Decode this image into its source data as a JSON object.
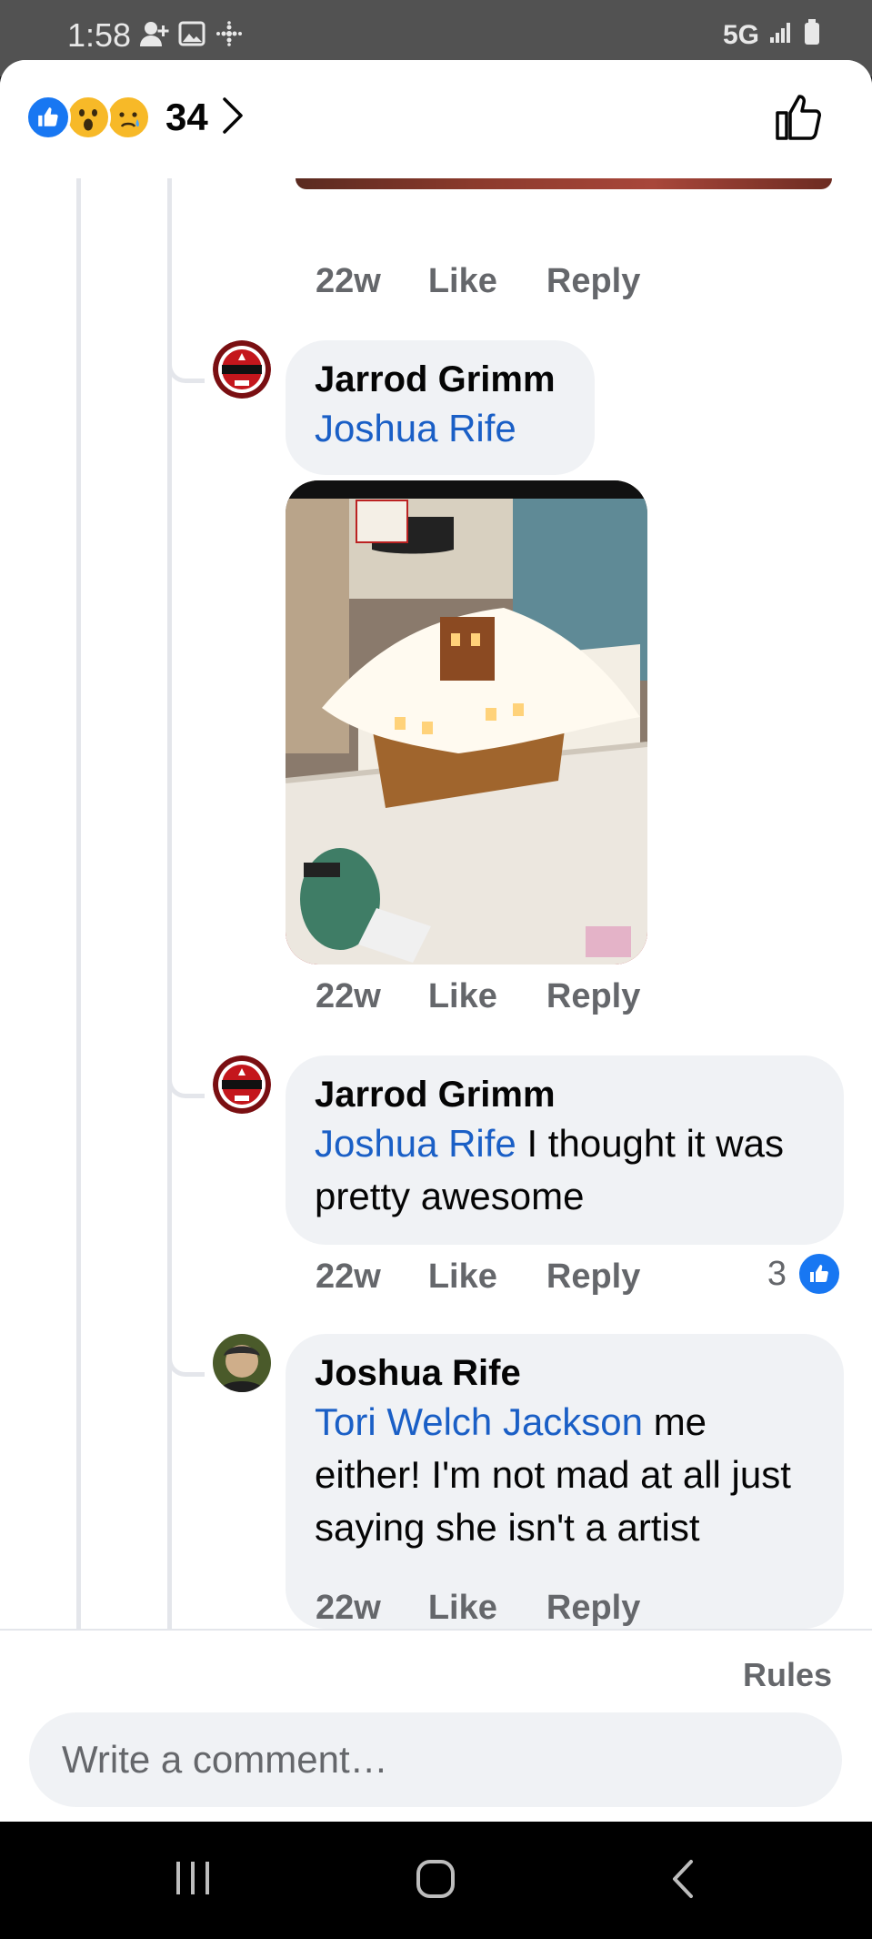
{
  "status_bar": {
    "time": "1:58",
    "network": "5G",
    "icons": [
      "person-add-icon",
      "image-icon",
      "dots-grid-icon",
      "signal-icon",
      "battery-icon"
    ]
  },
  "header": {
    "reaction_icons": [
      "like-reaction",
      "wow-reaction",
      "sad-reaction"
    ],
    "reaction_count": "34"
  },
  "comments": [
    {
      "author": "Jarrod Grimm",
      "mention": "Joshua Rife",
      "text": "",
      "has_image": true,
      "time": "22w",
      "like_label": "Like",
      "reply_label": "Reply"
    },
    {
      "author": "Jarrod Grimm",
      "mention": "Joshua Rife",
      "text": " I thought it was pretty awesome",
      "time": "22w",
      "like_label": "Like",
      "reply_label": "Reply",
      "like_count": "3"
    },
    {
      "author": "Joshua Rife",
      "mention": "Tori Welch Jackson",
      "text": " me either! I'm not mad at all just saying she isn't a artist",
      "time": "22w",
      "like_label": "Like",
      "reply_label": "Reply"
    }
  ],
  "previous_comment_meta": {
    "time": "22w",
    "like_label": "Like",
    "reply_label": "Reply"
  },
  "footer": {
    "rules_label": "Rules",
    "comment_placeholder": "Write a comment…"
  },
  "colors": {
    "mention": "#1a5fc6",
    "like_blue": "#1877f2",
    "bubble": "#f0f2f5",
    "meta_gray": "#65676b"
  }
}
